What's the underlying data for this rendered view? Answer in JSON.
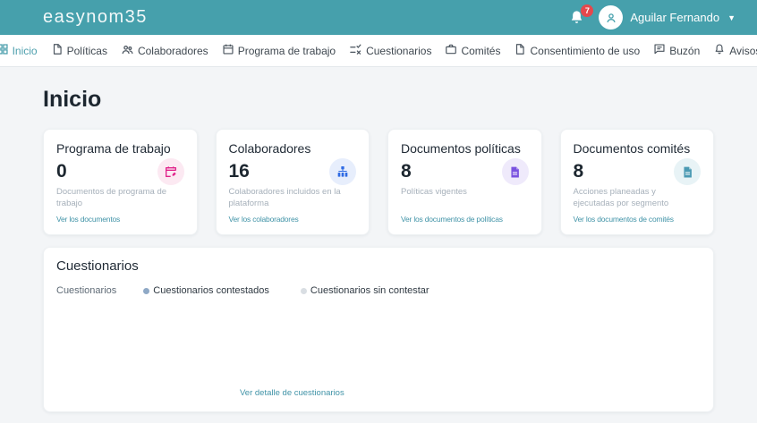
{
  "header": {
    "logo": "easynom35",
    "notification_count": "7",
    "user_name": "Aguilar Fernando"
  },
  "nav": {
    "items": [
      {
        "label": "Inicio",
        "icon": "dashboard-icon",
        "active": true
      },
      {
        "label": "Políticas",
        "icon": "document-icon",
        "active": false
      },
      {
        "label": "Colaboradores",
        "icon": "people-icon",
        "active": false
      },
      {
        "label": "Programa de trabajo",
        "icon": "calendar-icon",
        "active": false
      },
      {
        "label": "Cuestionarios",
        "icon": "checklist-icon",
        "active": false
      },
      {
        "label": "Comités",
        "icon": "briefcase-icon",
        "active": false
      },
      {
        "label": "Consentimiento de uso",
        "icon": "document-icon",
        "active": false
      },
      {
        "label": "Buzón",
        "icon": "chat-icon",
        "active": false
      },
      {
        "label": "Avisos",
        "icon": "bell-icon",
        "active": false
      }
    ]
  },
  "page": {
    "title": "Inicio"
  },
  "cards": [
    {
      "title": "Programa de trabajo",
      "value": "0",
      "description": "Documentos de programa de trabajo",
      "link": "Ver los documentos",
      "icon": "edit-calendar-icon",
      "icon_color": "#e0218a",
      "icon_bg": "#fce9f2"
    },
    {
      "title": "Colaboradores",
      "value": "16",
      "description": "Colaboradores incluidos en la plataforma",
      "link": "Ver los colaboradores",
      "icon": "org-chart-icon",
      "icon_color": "#2f6be4",
      "icon_bg": "#e7eefc"
    },
    {
      "title": "Documentos políticas",
      "value": "8",
      "description": "Políticas vigentes",
      "link": "Ver los documentos de políticas",
      "icon": "document-icon",
      "icon_color": "#7a52e0",
      "icon_bg": "#efeafb"
    },
    {
      "title": "Documentos comités",
      "value": "8",
      "description": "Acciones planeadas y ejecutadas por segmento",
      "link": "Ver los documentos de comités",
      "icon": "document-icon",
      "icon_color": "#4b9ab3",
      "icon_bg": "#e8f3f6"
    }
  ],
  "questionnaires": {
    "title": "Cuestionarios",
    "axis_label": "Cuestionarios",
    "legend": [
      {
        "label": "Cuestionarios contestados",
        "color": "#8fa9c6"
      },
      {
        "label": "Cuestionarios sin contestar",
        "color": "#d9dee3"
      }
    ],
    "link": "Ver detalle de cuestionarios"
  },
  "colors": {
    "header_bg": "#46a0ac",
    "accent_link": "#4294a8",
    "active_nav": "#4d9fad",
    "badge_red": "#e5484d",
    "page_bg": "#f3f5f7"
  }
}
